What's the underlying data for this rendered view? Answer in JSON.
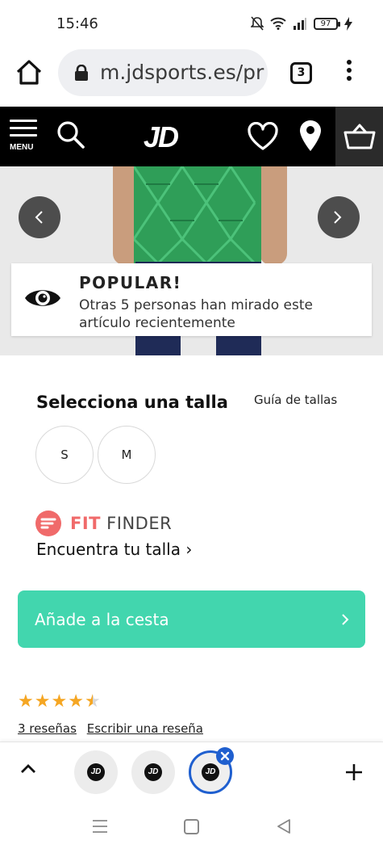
{
  "status_bar": {
    "time": "15:46",
    "battery": "97",
    "icons": [
      "mute-icon",
      "wifi-icon",
      "signal-icon",
      "battery-icon",
      "charging-icon"
    ]
  },
  "browser": {
    "url": "m.jdsports.es/pr",
    "tab_count": "3"
  },
  "header": {
    "menu_label": "MENU",
    "logo": "JD"
  },
  "popular": {
    "title": "POPULAR!",
    "description": "Otras 5 personas han mirado este artículo recientemente"
  },
  "size": {
    "title": "Selecciona una talla",
    "guide_label": "Guía de tallas",
    "options": [
      "S",
      "M"
    ]
  },
  "fit_finder": {
    "brand_fit": "FIT",
    "brand_finder": "FINDER",
    "link": "Encuentra tu talla ›"
  },
  "cart": {
    "add_label": "Añade a la cesta"
  },
  "rating": {
    "value": 4.5,
    "max": 5,
    "reviews_label": "3 reseñas",
    "write_label": "Escribir una reseña"
  },
  "colors": {
    "brand": "#000000",
    "cta": "#42d6ae",
    "fit_finder": "#f06a6a",
    "star": "#f5a623",
    "active_tab": "#1f5fcf"
  }
}
